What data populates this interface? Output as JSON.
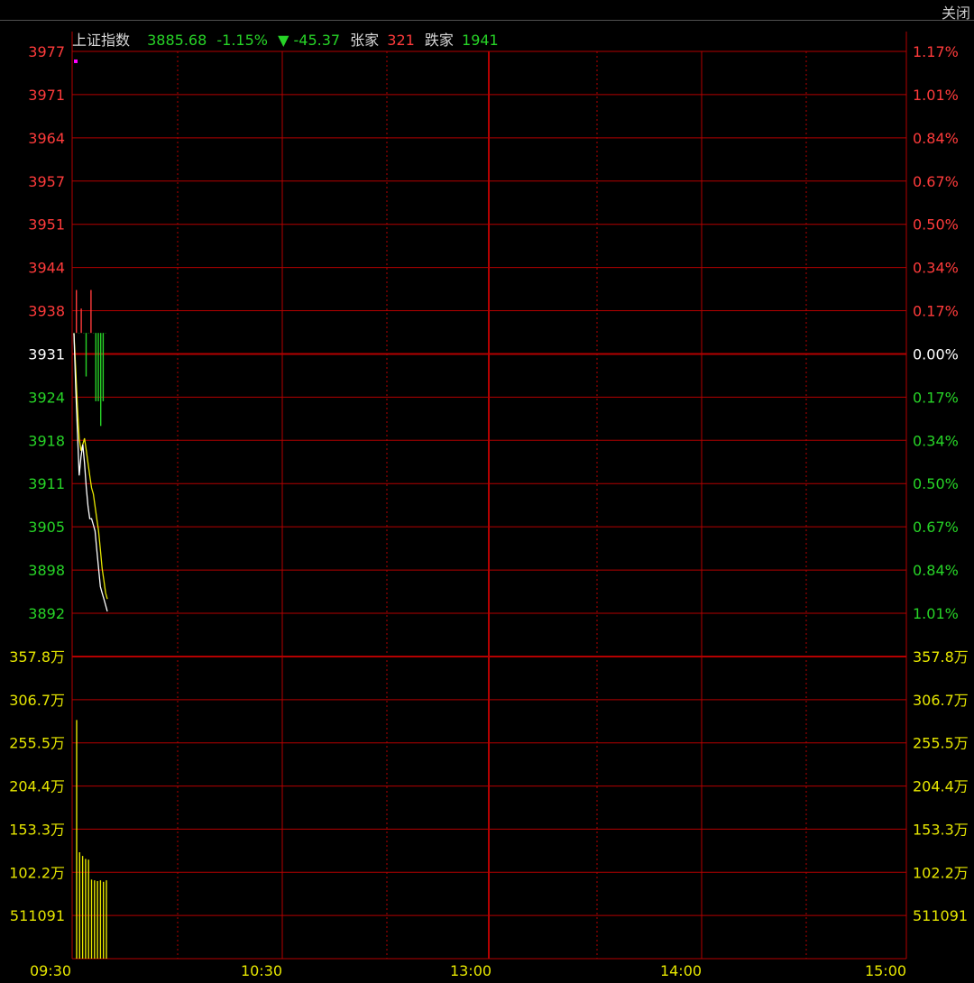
{
  "close_label": "关闭",
  "header": {
    "name": "上证指数",
    "price": "3885.68",
    "pct": "-1.15%",
    "arrow": "▼",
    "change": "-45.37",
    "up_label": "张家",
    "up_count": "321",
    "down_label": "跌家",
    "down_count": "1941"
  },
  "colors": {
    "grid": "#b40000",
    "up": "#ff3b3b",
    "down": "#27d427",
    "neutral": "#ffffff",
    "volume": "#e6e600",
    "avg_line": "#e6e600",
    "price_line": "#ffffff",
    "marker": "#ff00ff"
  },
  "chart_data": {
    "type": "line",
    "x_labels": [
      "09:30",
      "10:30",
      "13:00",
      "14:00",
      "15:00"
    ],
    "price_axis": {
      "left_labels": [
        "3977",
        "3971",
        "3964",
        "3957",
        "3951",
        "3944",
        "3938",
        "3931",
        "3924",
        "3918",
        "3911",
        "3905",
        "3898",
        "3892"
      ],
      "right_labels": [
        "1.17%",
        "1.01%",
        "0.84%",
        "0.67%",
        "0.50%",
        "0.34%",
        "0.17%",
        "0.00%",
        "0.17%",
        "0.34%",
        "0.50%",
        "0.67%",
        "0.84%",
        "1.01%"
      ],
      "ylim": [
        3885.7,
        3976.6
      ],
      "prev_close": 3931.05
    },
    "volume_axis": {
      "labels": [
        "357.8万",
        "306.7万",
        "255.5万",
        "204.4万",
        "153.3万",
        "102.2万",
        "511091"
      ],
      "ylim": [
        0,
        4089000
      ]
    },
    "series": [
      {
        "values": [
          3931,
          3922,
          3915,
          3908,
          3911,
          3913,
          3910,
          3906,
          3903,
          3901,
          3901,
          3900,
          3899,
          3896,
          3893,
          3890,
          3889,
          3888,
          3887,
          3886
        ]
      },
      {
        "values": [
          3931,
          3925,
          3919,
          3914,
          3912,
          3913,
          3914,
          3912,
          3910,
          3908,
          3906,
          3905,
          3903,
          3901,
          3899,
          3896,
          3893,
          3891,
          3889,
          3888
        ]
      }
    ],
    "advance_decline_bars": [
      3931,
      3938,
      3931,
      3935,
      3931,
      3924,
      3931,
      3938,
      3931,
      3920,
      3920,
      3916,
      3920,
      3931
    ],
    "volume": [
      3230000,
      1440000,
      1390000,
      1350000,
      1340000,
      1070000,
      1060000,
      1050000,
      1060000,
      1040000,
      1060000
    ],
    "marker_value": 3975
  }
}
